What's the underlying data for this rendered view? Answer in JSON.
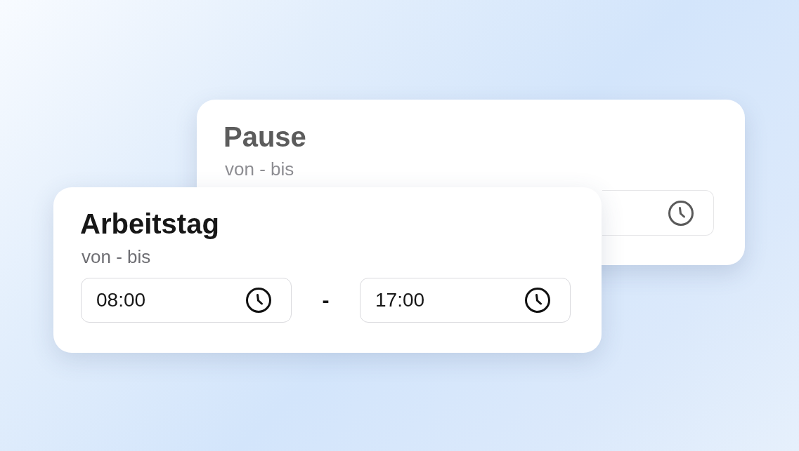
{
  "cards": [
    {
      "kind": "covered",
      "faded": true,
      "title": "Pause",
      "subtitle": "von - bis"
    },
    {
      "kind": "range",
      "faded": false,
      "title": "Arbeitstag",
      "subtitle": "von - bis",
      "from": "08:00",
      "separator": "-",
      "to": "17:00"
    }
  ]
}
